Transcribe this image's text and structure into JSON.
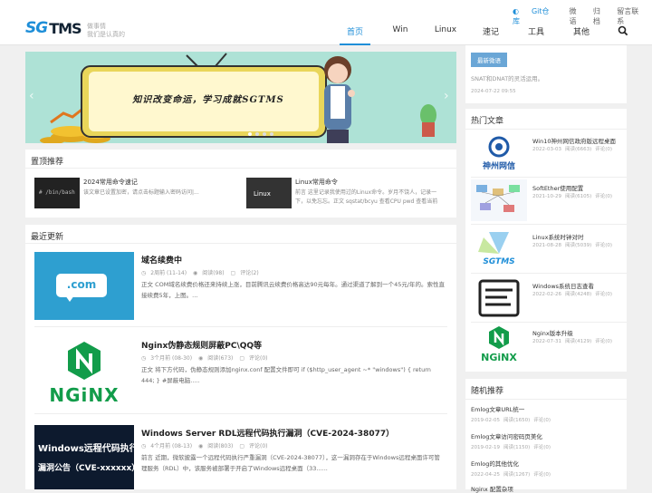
{
  "header": {
    "logo_a": "SG",
    "logo_b": "TMS",
    "slogan_1": "做事情",
    "slogan_2": "我们是认真的",
    "top_links": [
      "Git仓库",
      "微语",
      "归档",
      "留言联系"
    ],
    "nav": [
      "首页",
      "Win",
      "Linux",
      "速记",
      "工具",
      "其他"
    ],
    "active_nav": 0
  },
  "slider": {
    "text": "知识改变命运，学习成就SGTMS",
    "slides": 4,
    "active_slide": 1
  },
  "sticky": {
    "title": "置顶推荐",
    "items": [
      {
        "thumb": "# /bin/bash",
        "title": "2024常用命令速记",
        "desc": "该文章已设置加密，请点击标题输入密码访问|..."
      },
      {
        "thumb": "Linux",
        "title": "Linux常用命令",
        "desc": "前言 这里记录我使用过的Linux命令。岁月不饶人，记录一下，以免忘忘。正文 sqstat/bcyu 查看CPU pwd 查看当前"
      }
    ]
  },
  "latest": {
    "title": "最近更新",
    "articles": [
      {
        "title": "域名续费中",
        "date": "2周前 (11-14)",
        "views": "阅读(98)",
        "comments": "评论(2)",
        "desc": "正文 COM域名续费价格还来持续上涨，目前腾讯云续费价格高达90元每年。通过渠道了解到一个45元/年的。索性直接续费5年，上图。..."
      },
      {
        "title": "Nginx伪静态规则屏蔽PC\\QQ等",
        "date": "3个月前 (08-30)",
        "views": "阅读(673)",
        "comments": "评论(0)",
        "desc": "正文 将下方代码，伪静态规则添加nginx.conf 配置文件即可 if ($http_user_agent ~* \"windows\") { return 444; } #屏蔽电脑....."
      },
      {
        "title": "Windows Server RDL远程代码执行漏洞（CVE-2024-38077）",
        "date": "4个月前 (08-13)",
        "views": "阅读(803)",
        "comments": "评论(0)",
        "desc": "前言 近期，微软披露一个远程代码执行严重漏洞（CVE-2024-38077），这一漏洞存在于Windows远程桌面许可管理服务（RDL）中，该服务被部署于开启了Windows远程桌面（33......"
      }
    ],
    "com_label": ".com",
    "nginx_label": "NGiNX",
    "win_banner_1": "Windows远程代码执行",
    "win_banner_2": "漏洞公告（CVE-xxxxxx）"
  },
  "weiyu": {
    "tag": "最新微语",
    "text": "SNAT和DNAT的灵活运用。",
    "date": "2024-07-22 09:55"
  },
  "hot": {
    "title": "热门文章",
    "items": [
      {
        "title": "Win10神州网信政府版远程桌面",
        "date": "2022-03-03",
        "views": "阅读(6663)",
        "comments": "评论(0)",
        "thumb_text": "神州网信"
      },
      {
        "title": "SoftEther使用配置",
        "date": "2021-10-29",
        "views": "阅读(6105)",
        "comments": "评论(0)",
        "thumb_text": ""
      },
      {
        "title": "Linux系统时钟对时",
        "date": "2021-08-28",
        "views": "阅读(5039)",
        "comments": "评论(0)",
        "thumb_text": "SGTMS"
      },
      {
        "title": "Windows系统日志查看",
        "date": "2022-02-26",
        "views": "阅读(4248)",
        "comments": "评论(0)",
        "thumb_text": ""
      },
      {
        "title": "Nginx版本升级",
        "date": "2022-07-31",
        "views": "阅读(4129)",
        "comments": "评论(0)",
        "thumb_text": "NGiNX"
      }
    ]
  },
  "random": {
    "title": "随机推荐",
    "items": [
      {
        "title": "Emlog文章URL统一",
        "date": "2019-02-05",
        "views": "阅读(1650)",
        "comments": "评论(0)"
      },
      {
        "title": "Emlog文章访问密码页美化",
        "date": "2019-02-19",
        "views": "阅读(1150)",
        "comments": "评论(0)"
      },
      {
        "title": "Emlog的其他优化",
        "date": "2022-04-25",
        "views": "阅读(1267)",
        "comments": "评论(0)"
      }
    ],
    "partial_item": "Nginx 配置杂项"
  },
  "colors": {
    "accent": "#1e8ed8",
    "slider_bg": "#aee2d6",
    "nginx_green": "#129c4a"
  },
  "icons": {
    "search": "search-icon",
    "eye": "eye-icon",
    "comment": "comment-icon",
    "arrow_left": "chevron-left-icon",
    "arrow_right": "chevron-right-icon"
  }
}
